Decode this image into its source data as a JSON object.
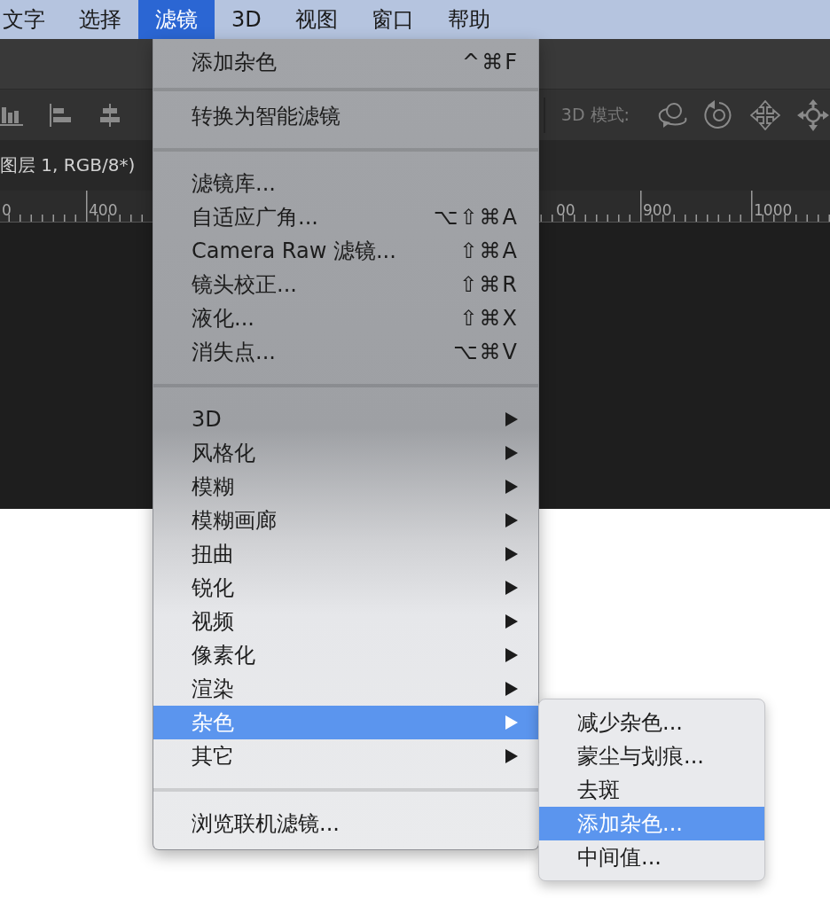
{
  "menu_bar": {
    "items": [
      {
        "label": "文字",
        "selected": false
      },
      {
        "label": "选择",
        "selected": false
      },
      {
        "label": "滤镜",
        "selected": true
      },
      {
        "label": "3D",
        "selected": false
      },
      {
        "label": "视图",
        "selected": false
      },
      {
        "label": "窗口",
        "selected": false
      },
      {
        "label": "帮助",
        "selected": false
      }
    ]
  },
  "options_bar": {
    "mode_label": "3D 模式:"
  },
  "document_tab": {
    "title": "图层 1, RGB/8*)"
  },
  "ruler": {
    "left_labels": [
      "0",
      "400"
    ],
    "right_labels": [
      "00",
      "900",
      "1000"
    ]
  },
  "filter_menu": {
    "items": [
      {
        "kind": "item",
        "label": "添加杂色",
        "shortcut": "^⌘F",
        "selected": false
      },
      {
        "kind": "separator"
      },
      {
        "kind": "item",
        "label": "转换为智能滤镜",
        "selected": false
      },
      {
        "kind": "separator"
      },
      {
        "kind": "item",
        "label": "滤镜库...",
        "selected": false
      },
      {
        "kind": "item",
        "label": "自适应广角...",
        "shortcut": "⌥⇧⌘A",
        "selected": false
      },
      {
        "kind": "item",
        "label": "Camera Raw 滤镜...",
        "shortcut": "⇧⌘A",
        "selected": false
      },
      {
        "kind": "item",
        "label": "镜头校正...",
        "shortcut": "⇧⌘R",
        "selected": false
      },
      {
        "kind": "item",
        "label": "液化...",
        "shortcut": "⇧⌘X",
        "selected": false
      },
      {
        "kind": "item",
        "label": "消失点...",
        "shortcut": "⌥⌘V",
        "selected": false
      },
      {
        "kind": "separator"
      },
      {
        "kind": "submenu",
        "label": "3D",
        "selected": false
      },
      {
        "kind": "submenu",
        "label": "风格化",
        "selected": false
      },
      {
        "kind": "submenu",
        "label": "模糊",
        "selected": false
      },
      {
        "kind": "submenu",
        "label": "模糊画廊",
        "selected": false
      },
      {
        "kind": "submenu",
        "label": "扭曲",
        "selected": false
      },
      {
        "kind": "submenu",
        "label": "锐化",
        "selected": false
      },
      {
        "kind": "submenu",
        "label": "视频",
        "selected": false
      },
      {
        "kind": "submenu",
        "label": "像素化",
        "selected": false
      },
      {
        "kind": "submenu",
        "label": "渲染",
        "selected": false
      },
      {
        "kind": "submenu",
        "label": "杂色",
        "selected": true,
        "submenu": {
          "items": [
            {
              "label": "减少杂色...",
              "selected": false
            },
            {
              "label": "蒙尘与划痕...",
              "selected": false
            },
            {
              "label": "去斑",
              "selected": false
            },
            {
              "label": "添加杂色...",
              "selected": true
            },
            {
              "label": "中间值...",
              "selected": false
            }
          ]
        }
      },
      {
        "kind": "submenu",
        "label": "其它",
        "selected": false
      },
      {
        "kind": "separator"
      },
      {
        "kind": "item",
        "label": "浏览联机滤镜...",
        "selected": false
      }
    ]
  }
}
